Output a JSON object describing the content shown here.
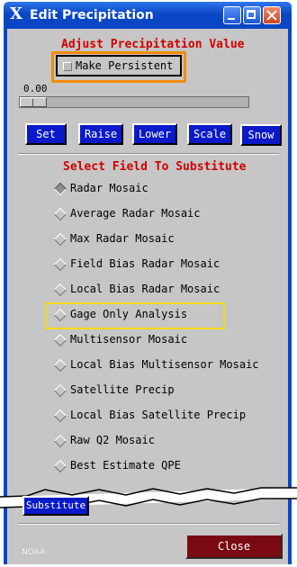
{
  "window": {
    "title": "Edit Precipitation",
    "title_icon": "X"
  },
  "adjust": {
    "heading": "Adjust Precipitation Value",
    "persistent_label": "Make Persistent",
    "slider_value": "0.00",
    "slider_fraction": 0.0
  },
  "buttons": {
    "set": "Set",
    "raise": "Raise",
    "lower": "Lower",
    "scale": "Scale",
    "snow": "Snow"
  },
  "substitute": {
    "heading": "Select Field To Substitute",
    "selected_index": 0,
    "options": [
      "Radar Mosaic",
      "Average Radar Mosaic",
      "Max Radar Mosaic",
      "Field Bias Radar Mosaic",
      "Local Bias Radar Mosaic",
      "Gage Only Analysis",
      "Multisensor Mosaic",
      "Local Bias Multisensor Mosaic",
      "Satellite Precip",
      "Local Bias Satellite Precip",
      "Raw Q2 Mosaic",
      "Best Estimate QPE"
    ],
    "button_label": "Substitute"
  },
  "footer": {
    "logo_text": "NOAA",
    "close_label": "Close"
  },
  "colors": {
    "button_blue": "#0a1ac9",
    "heading_red": "#d00000",
    "close_maroon": "#7a0a12",
    "highlight_orange": "#f28c0a",
    "highlight_yellow": "#f2dc10"
  }
}
